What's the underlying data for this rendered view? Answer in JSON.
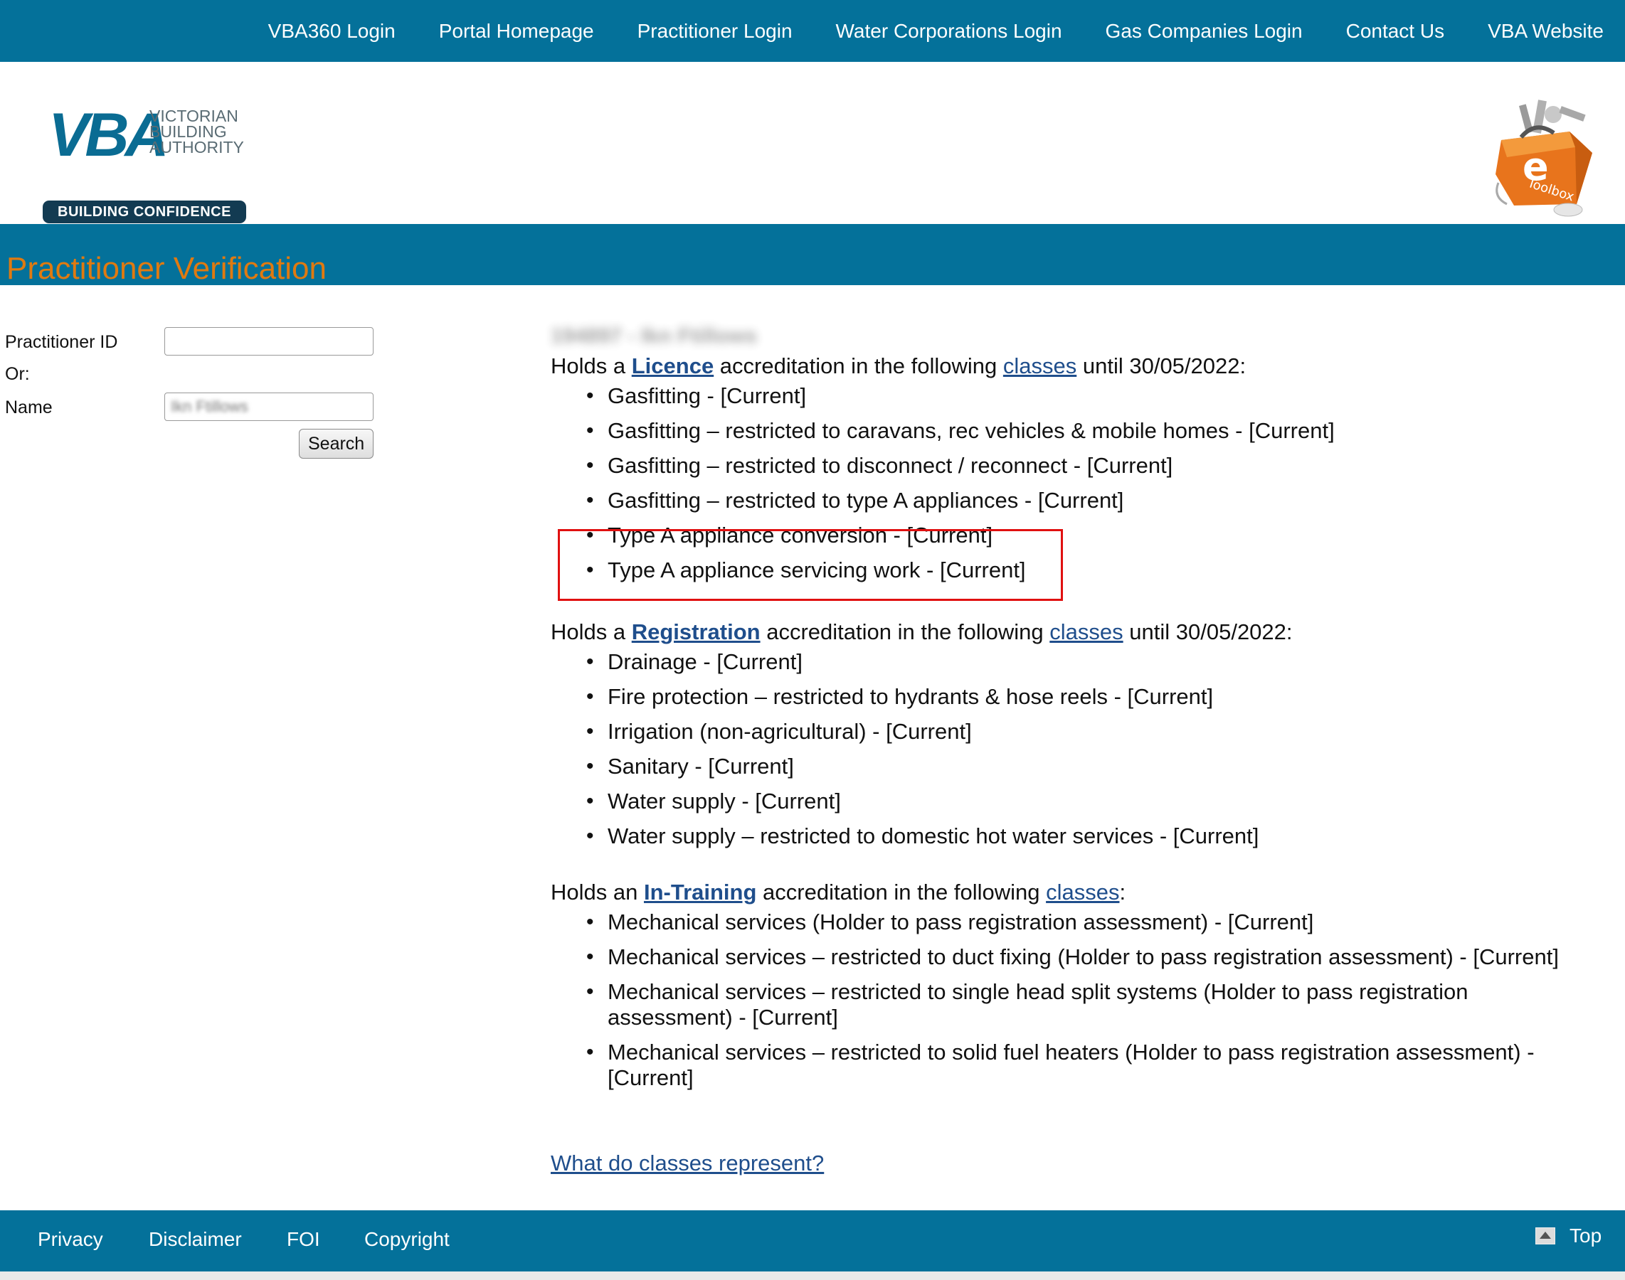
{
  "topnav": {
    "links": [
      "VBA360 Login",
      "Portal Homepage",
      "Practitioner Login",
      "Water Corporations Login",
      "Gas Companies Login",
      "Contact Us",
      "VBA Website"
    ]
  },
  "logo": {
    "mark": "VBA",
    "org_lines": [
      "VICTORIAN",
      "BUILDING",
      "AUTHORITY"
    ],
    "tagline": "BUILDING CONFIDENCE"
  },
  "etoolbox": {
    "icon": "e-toolbox-icon",
    "letter": "e",
    "text": "Toolbox"
  },
  "page_title": "Practitioner Verification",
  "search": {
    "id_label": "Practitioner ID",
    "id_value": "",
    "or_label": "Or:",
    "name_label": "Name",
    "name_value": "Ikn Ftillows",
    "button": "Search"
  },
  "results": {
    "person_heading": "194897 - Ikn Ftillows",
    "licence": {
      "prefix": "Holds a ",
      "type": "Licence",
      "mid": " accreditation in the following ",
      "classes_link": "classes",
      "suffix": " until 30/05/2022:",
      "items": [
        "Gasfitting - [Current]",
        "Gasfitting – restricted to caravans, rec vehicles & mobile homes - [Current]",
        "Gasfitting – restricted to disconnect / reconnect - [Current]",
        "Gasfitting – restricted to type A appliances - [Current]",
        "Type A appliance conversion - [Current]",
        "Type A appliance servicing work - [Current]"
      ]
    },
    "registration": {
      "prefix": "Holds a ",
      "type": "Registration",
      "mid": " accreditation in the following ",
      "classes_link": "classes",
      "suffix": " until 30/05/2022:",
      "items": [
        "Drainage - [Current]",
        "Fire protection – restricted to hydrants & hose reels - [Current]",
        "Irrigation (non-agricultural) - [Current]",
        "Sanitary - [Current]",
        "Water supply - [Current]",
        "Water supply – restricted to domestic hot water services - [Current]"
      ]
    },
    "training": {
      "prefix": "Holds an ",
      "type": "In-Training",
      "mid": " accreditation in the following ",
      "classes_link": "classes",
      "suffix": ":",
      "items": [
        "Mechanical services (Holder to pass registration assessment) - [Current]",
        "Mechanical services – restricted to duct fixing (Holder to pass registration assessment) - [Current]",
        "Mechanical services – restricted to single head split systems (Holder to pass registration assessment) - [Current]",
        "Mechanical services – restricted to solid fuel heaters (Holder to pass registration assessment) - [Current]"
      ]
    },
    "classes_help_link": "What do classes represent?"
  },
  "footer": {
    "privacy": "Privacy",
    "disclaimer": "Disclaimer",
    "foi": "FOI",
    "copyright": "Copyright",
    "top": "Top"
  },
  "colors": {
    "brand_blue": "#04719a",
    "title_orange": "#e07a10",
    "link_blue": "#1f4e8c",
    "highlight_red": "#e01010"
  }
}
